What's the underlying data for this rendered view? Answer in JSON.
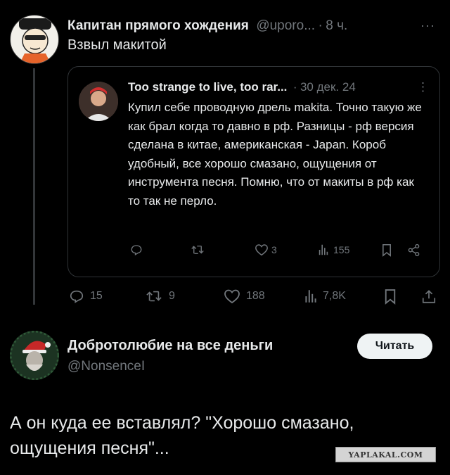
{
  "main_tweet": {
    "author_name": "Капитан прямого хождения",
    "handle": "@uporo...",
    "separator": "·",
    "time": "8 ч.",
    "more": "···",
    "text": "Взвыл макитой",
    "stats": {
      "replies": "15",
      "retweets": "9",
      "likes": "188",
      "views": "7,8K"
    }
  },
  "quoted_tweet": {
    "author_name": "Too strange to live, too rar...",
    "separator": "·",
    "date": "30 дек. 24",
    "more": "⋮",
    "text": "Купил себе проводную дрель makita. Точно такую же как брал когда то давно в рф. Разницы - рф версия сделана в китае, американская - Japan. Короб удобный, все хорошо смазано, ощущения от инструмента песня. Помню, что от макиты в рф как то так не перло.",
    "stats": {
      "likes": "3",
      "views": "155"
    }
  },
  "reply_user": {
    "name": "Добротолюбие на все деньги",
    "handle": "@NonsenceI",
    "follow_label": "Читать"
  },
  "comment": "А он куда ее вставлял? \"Хорошо смазано, ощущения песня\"...",
  "watermark": "YAPLAKAL.COM",
  "colors": {
    "background": "#000000",
    "text": "#e7e9ea",
    "muted": "#71767b",
    "border": "#2f3336",
    "button": "#eff3f4"
  },
  "icons": [
    "reply-icon",
    "retweet-icon",
    "like-icon",
    "views-icon",
    "bookmark-icon",
    "share-icon"
  ]
}
